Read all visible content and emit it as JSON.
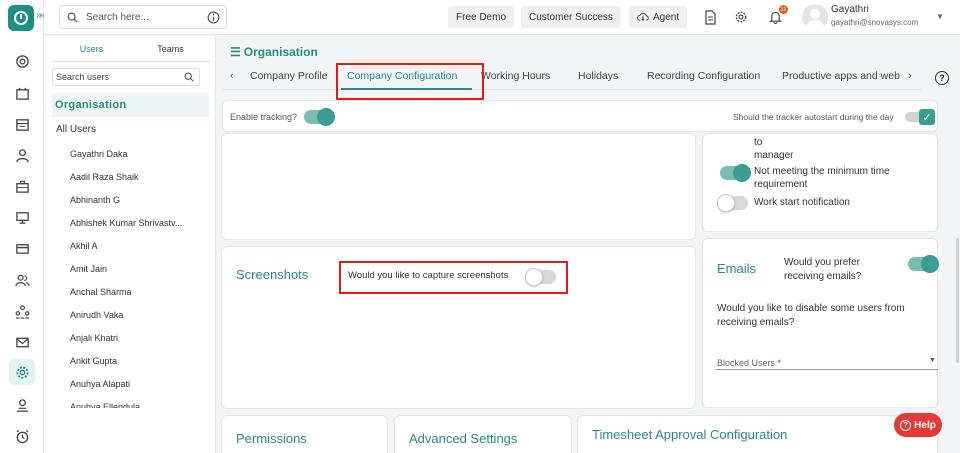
{
  "topbar": {
    "search_placeholder": "Search here...",
    "buttons": [
      "Free Demo",
      "Customer Success",
      "Agent"
    ],
    "notification_count": "11",
    "user_name": "Gayathri",
    "user_email": "gayathri@snovasys.com"
  },
  "sidebar": {
    "tabs": [
      "Users",
      "Teams"
    ],
    "search_placeholder": "Search users",
    "org_label": "Organisation",
    "all_users_label": "All Users",
    "users": [
      "Gayathri Daka",
      "Aadil Raza Shaik",
      "Abhinanth G",
      "Abhishek Kumar Shrivastv...",
      "Akhil A",
      "Amit Jain",
      "Anchal Sharma",
      "Anirudh Vaka",
      "Anjali Khatri",
      "Ankit Gupta",
      "Anuhya Alapati",
      "Anuhya Ellendula"
    ]
  },
  "main": {
    "breadcrumb": "Organisation",
    "tabs": [
      "Company Profile",
      "Company Configuration",
      "Working Hours",
      "Holidays",
      "Recording Configuration",
      "Productive apps and web"
    ],
    "active_tab": "Company Configuration",
    "tracking": {
      "enable_label": "Enable tracking?",
      "enable_value": true,
      "autostart_label": "Should the tracker autostart during the day",
      "autostart_value": true
    },
    "notifications": {
      "line_to": "to",
      "line_manager": "manager",
      "min_time_label": "Not meeting the minimum time requirement",
      "min_time_value": true,
      "work_start_label": "Work start notification",
      "work_start_value": false
    },
    "screenshots": {
      "title": "Screenshots",
      "question": "Would you like to capture screenshots",
      "value": false
    },
    "emails": {
      "title": "Emails",
      "prefer_label": "Would you prefer receiving emails?",
      "prefer_value": true,
      "disable_label": "Would you like to disable some users from receiving emails?",
      "blocked_label": "Blocked Users",
      "required_mark": "*"
    },
    "bottom_cards": [
      "Permissions",
      "Advanced Settings",
      "Timesheet Approval Configuration"
    ],
    "help_label": "Help"
  },
  "colors": {
    "accent": "#2a8a80",
    "highlight": "#e01b1b",
    "help": "#e53935"
  }
}
